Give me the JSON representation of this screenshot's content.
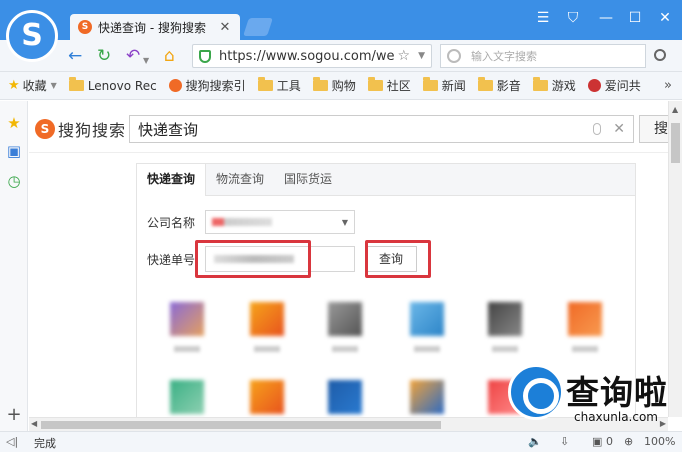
{
  "window": {
    "tab_title": "快递查询 - 搜狗搜索",
    "tab_favicon_letter": "S",
    "controls": [
      "☰",
      "⛉",
      "—",
      "☐",
      "✕"
    ]
  },
  "navbar": {
    "url": "https://www.sogou.com/we",
    "search_placeholder": "输入文字搜索"
  },
  "bookmarks": {
    "items": [
      {
        "label": "收藏",
        "icon": "star-icon"
      },
      {
        "label": "Lenovo Rec",
        "icon": "folder-icon"
      },
      {
        "label": "搜狗搜索引",
        "icon": "sogou-icon"
      },
      {
        "label": "工具",
        "icon": "folder-icon"
      },
      {
        "label": "购物",
        "icon": "folder-icon"
      },
      {
        "label": "社区",
        "icon": "folder-icon"
      },
      {
        "label": "新闻",
        "icon": "folder-icon"
      },
      {
        "label": "影音",
        "icon": "folder-icon"
      },
      {
        "label": "游戏",
        "icon": "folder-icon"
      },
      {
        "label": "爱问共",
        "icon": "avatar-icon"
      }
    ],
    "more": "»"
  },
  "page": {
    "logo_text": "搜狗搜索",
    "query": "快递查询",
    "search_button": "搜",
    "card": {
      "tabs": [
        "快递查询",
        "物流查询",
        "国际货运"
      ],
      "company_label": "公司名称",
      "number_label": "快递单号",
      "query_button": "查询"
    }
  },
  "statusbar": {
    "status": "完成",
    "download_count": "0",
    "zoom": "100%"
  },
  "watermark": {
    "brand": "查询啦",
    "domain": "chaxunla.com"
  },
  "colors": {
    "brand_blue": "#3b8fe6",
    "sogou_orange": "#f06a26",
    "highlight_red": "#d9363e"
  }
}
